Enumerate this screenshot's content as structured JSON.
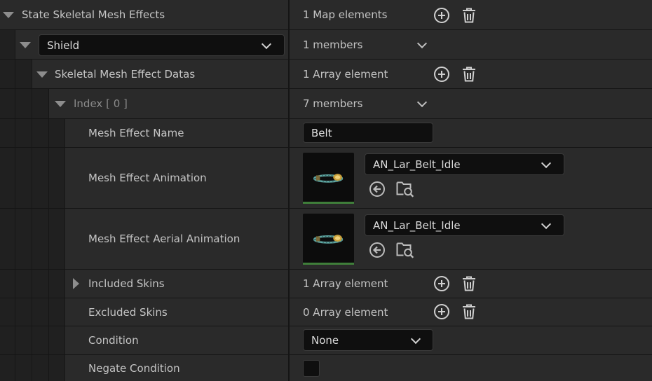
{
  "rows": {
    "state_effects": {
      "label": "State Skeletal Mesh Effects",
      "value": "1 Map elements"
    },
    "shield": {
      "key": "Shield",
      "value": "1 members"
    },
    "effect_datas": {
      "label": "Skeletal Mesh Effect Datas",
      "value": "1 Array element"
    },
    "index": {
      "label": "Index",
      "index": "[ 0 ]",
      "value": "7 members"
    },
    "effect_name": {
      "label": "Mesh Effect Name",
      "value": "Belt"
    },
    "effect_anim": {
      "label": "Mesh Effect Animation",
      "asset": "AN_Lar_Belt_Idle"
    },
    "aerial_anim": {
      "label": "Mesh Effect Aerial Animation",
      "asset": "AN_Lar_Belt_Idle"
    },
    "included_skins": {
      "label": "Included Skins",
      "value": "1 Array element"
    },
    "excluded_skins": {
      "label": "Excluded Skins",
      "value": "0 Array element"
    },
    "condition": {
      "label": "Condition",
      "value": "None"
    },
    "negate": {
      "label": "Negate Condition",
      "checked": false
    }
  },
  "icons": {
    "add": "plus-circle-icon",
    "delete": "trash-icon",
    "use_selected": "arrow-left-circle-icon",
    "browse": "folder-search-icon",
    "expand": "triangle-down-icon",
    "collapse": "triangle-right-icon",
    "dropdown": "chevron-down-icon"
  },
  "colors": {
    "panel": "#2a2a2a",
    "input": "#0f0f0f",
    "thumb_bar": "#3f7e3a",
    "icon": "#d0d0d0"
  }
}
